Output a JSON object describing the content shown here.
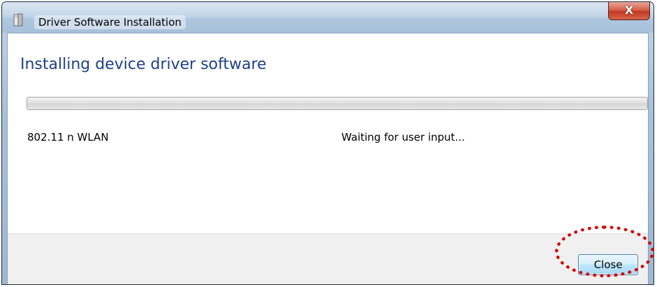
{
  "window": {
    "title": "Driver Software Installation",
    "close_glyph": "X"
  },
  "heading": "Installing device driver software",
  "progress": {
    "value_percent": 0
  },
  "device": {
    "name": "802.11 n WLAN",
    "status": "Waiting for user input..."
  },
  "footer": {
    "close_label": "Close"
  },
  "colors": {
    "heading": "#1e3f8a",
    "highlight_ring": "#d40000",
    "close_button_border": "#3c7fb1"
  },
  "icons": {
    "title": "driver-box-icon",
    "close": "close-x-icon"
  }
}
